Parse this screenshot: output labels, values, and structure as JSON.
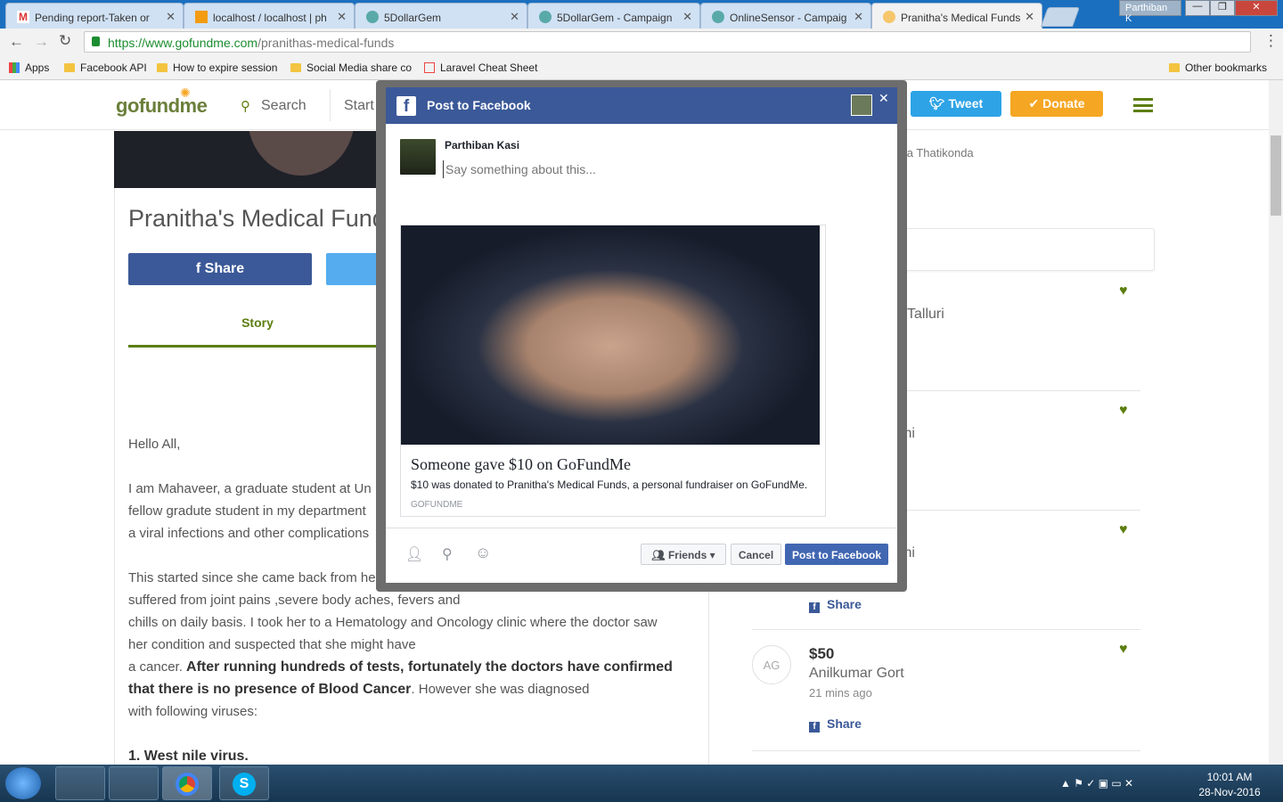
{
  "browser": {
    "tabs": [
      {
        "title": "Pending report-Taken or",
        "icon": "gmail-icon"
      },
      {
        "title": "localhost / localhost | ph",
        "icon": "phpmyadmin-icon"
      },
      {
        "title": "5DollarGem",
        "icon": "globe-icon"
      },
      {
        "title": "5DollarGem - Campaign",
        "icon": "globe-icon"
      },
      {
        "title": "OnlineSensor - Campaig",
        "icon": "globe-icon"
      },
      {
        "title": "Pranitha's Medical Funds",
        "icon": "gofundme-icon",
        "active": true
      }
    ],
    "user_label": "Parthiban K",
    "url_prefix": "https://www.gofundme.com",
    "url_path": "/pranithas-medical-funds",
    "bookmarks": [
      {
        "label": "Apps",
        "icon": "apps-grid-icon"
      },
      {
        "label": "Facebook API",
        "icon": "folder-icon"
      },
      {
        "label": "How to expire session",
        "icon": "folder-icon"
      },
      {
        "label": "Social Media share co",
        "icon": "folder-icon"
      },
      {
        "label": "Laravel Cheat Sheet",
        "icon": "laravel-icon"
      }
    ],
    "other_bookmarks": "Other bookmarks"
  },
  "site": {
    "logo": "gofundme",
    "search_label": "Search",
    "start_label": "Start a",
    "tweet_label": "Tweet",
    "donate_label": "Donate",
    "campaign_title": "Pranitha's Medical Funds",
    "share_label": "Share",
    "story_tab": "Story",
    "organizer_partial": "itha Thatikonda",
    "story": {
      "greeting": "Hello All,",
      "p1": [
        "I am Mahaveer, a graduate student at Un",
        "fellow gradute student in my department",
        "a viral infections and other complications"
      ],
      "p2": [
        "This started since she came back from he",
        "suffered from joint pains ,severe body aches, fevers and",
        "chills on daily basis. I took her to a Hematology and Oncology clinic where the doctor saw",
        "her condition and suspected that she might have"
      ],
      "p3_a": "a cancer. ",
      "p3_bold1": "After running hundreds of tests, fortunately the doctors have confirmed",
      "p3_bold2": "that there is no presence of Blood Cancer",
      "p3_b": ". However she was diagnosed",
      "p3_c": "with following viruses:",
      "list_item": "1. West nile virus."
    },
    "donations": [
      {
        "name_partial": "Talluri"
      },
      {
        "name_partial": "thi"
      },
      {
        "name_partial": "thi",
        "share": "Share"
      },
      {
        "initials": "AG",
        "amount": "$50",
        "name": "Anilkumar Gort",
        "time": "21 mins ago",
        "share": "Share"
      }
    ]
  },
  "modal": {
    "title": "Post to Facebook",
    "user_name": "Parthiban Kasi",
    "placeholder": "Say something about this...",
    "preview_title": "Someone gave $10 on GoFundMe",
    "preview_desc": "$10 was donated to Pranitha's Medical Funds, a personal fundraiser on GoFundMe.",
    "preview_domain": "GOFUNDME",
    "audience": "Friends",
    "cancel": "Cancel",
    "post": "Post to Facebook"
  },
  "taskbar": {
    "time": "10:01 AM",
    "date": "28-Nov-2016",
    "apps": [
      "start-orb-icon",
      "virtualbox-icon",
      "file-explorer-icon",
      "chrome-icon",
      "skype-icon"
    ]
  },
  "colors": {
    "fb_blue": "#3b5998",
    "gfm_green": "#5c7e10",
    "tweet_blue": "#2ea3e6",
    "donate_orange": "#f5a623"
  }
}
